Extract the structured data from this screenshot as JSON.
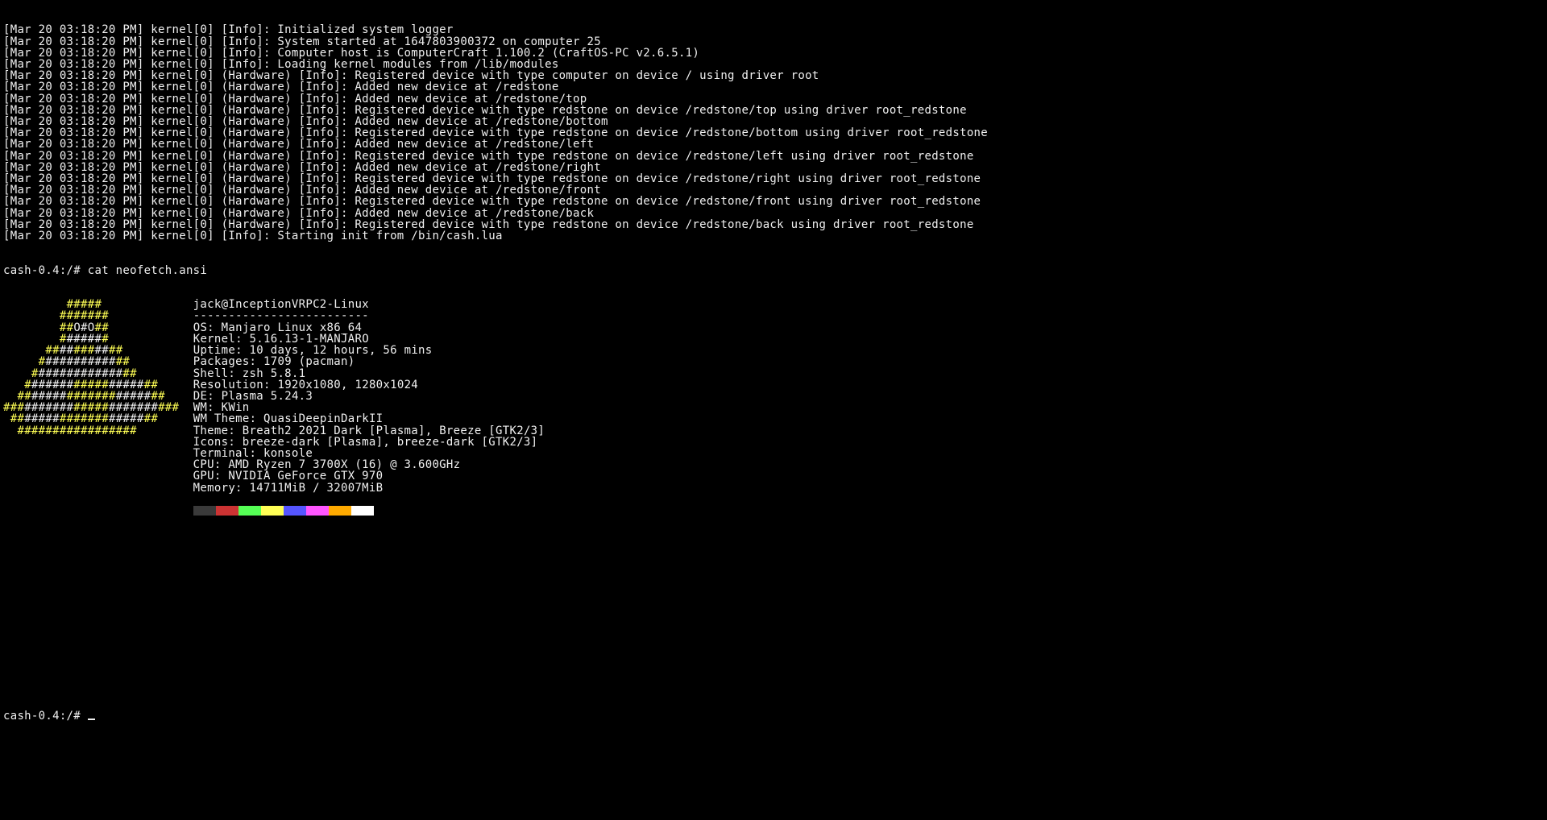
{
  "kernel_log": [
    "[Mar 20 03:18:20 PM] kernel[0] [Info]: Initialized system logger",
    "[Mar 20 03:18:20 PM] kernel[0] [Info]: System started at 1647803900372 on computer 25",
    "[Mar 20 03:18:20 PM] kernel[0] [Info]: Computer host is ComputerCraft 1.100.2 (CraftOS-PC v2.6.5.1)",
    "[Mar 20 03:18:20 PM] kernel[0] [Info]: Loading kernel modules from /lib/modules",
    "[Mar 20 03:18:20 PM] kernel[0] (Hardware) [Info]: Registered device with type computer on device / using driver root",
    "[Mar 20 03:18:20 PM] kernel[0] (Hardware) [Info]: Added new device at /redstone",
    "[Mar 20 03:18:20 PM] kernel[0] (Hardware) [Info]: Added new device at /redstone/top",
    "[Mar 20 03:18:20 PM] kernel[0] (Hardware) [Info]: Registered device with type redstone on device /redstone/top using driver root_redstone",
    "[Mar 20 03:18:20 PM] kernel[0] (Hardware) [Info]: Added new device at /redstone/bottom",
    "[Mar 20 03:18:20 PM] kernel[0] (Hardware) [Info]: Registered device with type redstone on device /redstone/bottom using driver root_redstone",
    "[Mar 20 03:18:20 PM] kernel[0] (Hardware) [Info]: Added new device at /redstone/left",
    "[Mar 20 03:18:20 PM] kernel[0] (Hardware) [Info]: Registered device with type redstone on device /redstone/left using driver root_redstone",
    "[Mar 20 03:18:20 PM] kernel[0] (Hardware) [Info]: Added new device at /redstone/right",
    "[Mar 20 03:18:20 PM] kernel[0] (Hardware) [Info]: Registered device with type redstone on device /redstone/right using driver root_redstone",
    "[Mar 20 03:18:20 PM] kernel[0] (Hardware) [Info]: Added new device at /redstone/front",
    "[Mar 20 03:18:20 PM] kernel[0] (Hardware) [Info]: Registered device with type redstone on device /redstone/front using driver root_redstone",
    "[Mar 20 03:18:20 PM] kernel[0] (Hardware) [Info]: Added new device at /redstone/back",
    "[Mar 20 03:18:20 PM] kernel[0] (Hardware) [Info]: Registered device with type redstone on device /redstone/back using driver root_redstone",
    "[Mar 20 03:18:20 PM] kernel[0] [Info]: Starting init from /bin/cash.lua"
  ],
  "prompt1": "cash-0.4:/# cat neofetch.ansi",
  "logo_lines": [
    {
      "pad": "         ",
      "ytxt": "#####",
      "wtxt": ""
    },
    {
      "pad": "        ",
      "ytxt": "#######",
      "wtxt": ""
    },
    {
      "pad": "        ",
      "ytxt": "##",
      "wtxt": "O#O",
      "ytxt2": "##"
    },
    {
      "pad": "        ",
      "ytxt": "#",
      "wtxt": "#####",
      "ytxt2": "#"
    },
    {
      "pad": "      ",
      "ytxt": "##",
      "wtxt": "##",
      "ytxt2": "###",
      "wtxt2": "##",
      "ytxt3": "##"
    },
    {
      "pad": "     ",
      "ytxt": "#",
      "wtxt": "##########",
      "ytxt2": "##"
    },
    {
      "pad": "    ",
      "ytxt": "#",
      "wtxt": "############",
      "ytxt2": "##"
    },
    {
      "pad": "   ",
      "ytxt": "#",
      "wtxt": "######",
      "ytxt2": "#####",
      "wtxt2": "#####",
      "ytxt3": "##"
    },
    {
      "pad": "  ",
      "ytxt": "##",
      "wtxt": "#####",
      "ytxt2": "#######",
      "wtxt2": "#####",
      "ytxt3": "##"
    },
    {
      "pad": "",
      "ytxt": "###",
      "wtxt": "#######",
      "ytxt2": "#####",
      "wtxt2": "#######",
      "ytxt3": "###"
    },
    {
      "pad": " ",
      "ytxt": "",
      "wtxt": "#####",
      "ytxt2": "#######",
      "wtxt2": "#####",
      "ywrap": true
    },
    {
      "pad": "  ",
      "ytxt": "#################",
      "wtxt": ""
    }
  ],
  "neofetch": {
    "userhost": "jack@InceptionVRPC2-Linux",
    "rule": "-------------------------",
    "os": "OS: Manjaro Linux x86_64",
    "kernel": "Kernel: 5.16.13-1-MANJARO",
    "uptime": "Uptime: 10 days, 12 hours, 56 mins",
    "packages": "Packages: 1709 (pacman)",
    "shell": "Shell: zsh 5.8.1",
    "resolution": "Resolution: 1920x1080, 1280x1024",
    "de": "DE: Plasma 5.24.3",
    "wm": "WM: KWin",
    "wmtheme": "WM Theme: QuasiDeepinDarkII",
    "theme": "Theme: Breath2 2021 Dark [Plasma], Breeze [GTK2/3]",
    "icons": "Icons: breeze-dark [Plasma], breeze-dark [GTK2/3]",
    "terminal": "Terminal: konsole",
    "cpu": "CPU: AMD Ryzen 7 3700X (16) @ 3.600GHz",
    "gpu": "GPU: NVIDIA GeForce GTX 970",
    "memory": "Memory: 14711MiB / 32007MiB"
  },
  "swatches": [
    "#3a3a3a",
    "#cc3333",
    "#55ff55",
    "#ffff55",
    "#5555ff",
    "#ff55ff",
    "#ffaa00",
    "#ffffff"
  ],
  "prompt2": "cash-0.4:/# "
}
